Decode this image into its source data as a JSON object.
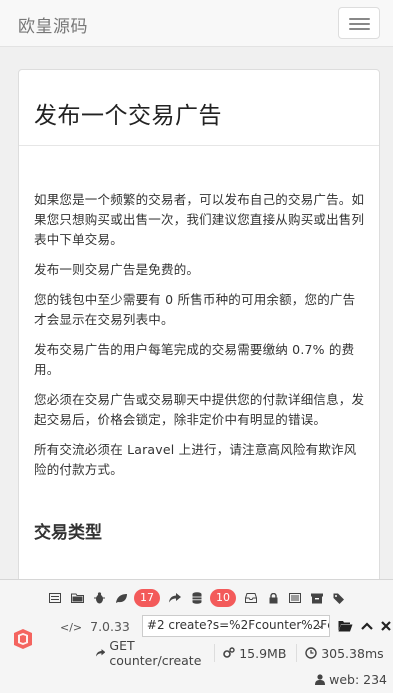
{
  "navbar": {
    "brand": "欧皇源码",
    "toggle_label": "toggle-navigation"
  },
  "panel": {
    "title": "发布一个交易广告",
    "paragraphs": [
      "如果您是一个频繁的交易者，可以发布自己的交易广告。如果您只想购买或出售一次，我们建议您直接从购买或出售列表中下单交易。",
      "发布一则交易广告是免费的。",
      "您的钱包中至少需要有 0 所售币种的可用余额，您的广告才会显示在交易列表中。",
      "发布交易广告的用户每笔完成的交易需要缴纳 0.7% 的费用。",
      "您必须在交易广告或交易聊天中提供您的付款详细信息，发起交易后，价格会锁定，除非定价中有明显的错误。",
      "所有交流必须在 Laravel 上进行，请注意高风险有欺诈风险的付款方式。"
    ],
    "section_title": "交易类型"
  },
  "debugbar": {
    "badges": {
      "views": "17",
      "queries": "10"
    },
    "php_version": "7.0.33",
    "request_select": "#2 create?s=%2Fcounter%2Fc",
    "route": "GET counter/create",
    "memory": "15.9MB",
    "time": "305.38ms",
    "user": "web: 234",
    "icons": [
      "messages-icon",
      "folder-icon",
      "bug-icon",
      "leaf-icon",
      "share-icon",
      "database-icon",
      "inbox-icon",
      "lock-icon",
      "list-icon",
      "archive-icon",
      "tags-icon"
    ],
    "accent_color": "#f35a5a"
  }
}
